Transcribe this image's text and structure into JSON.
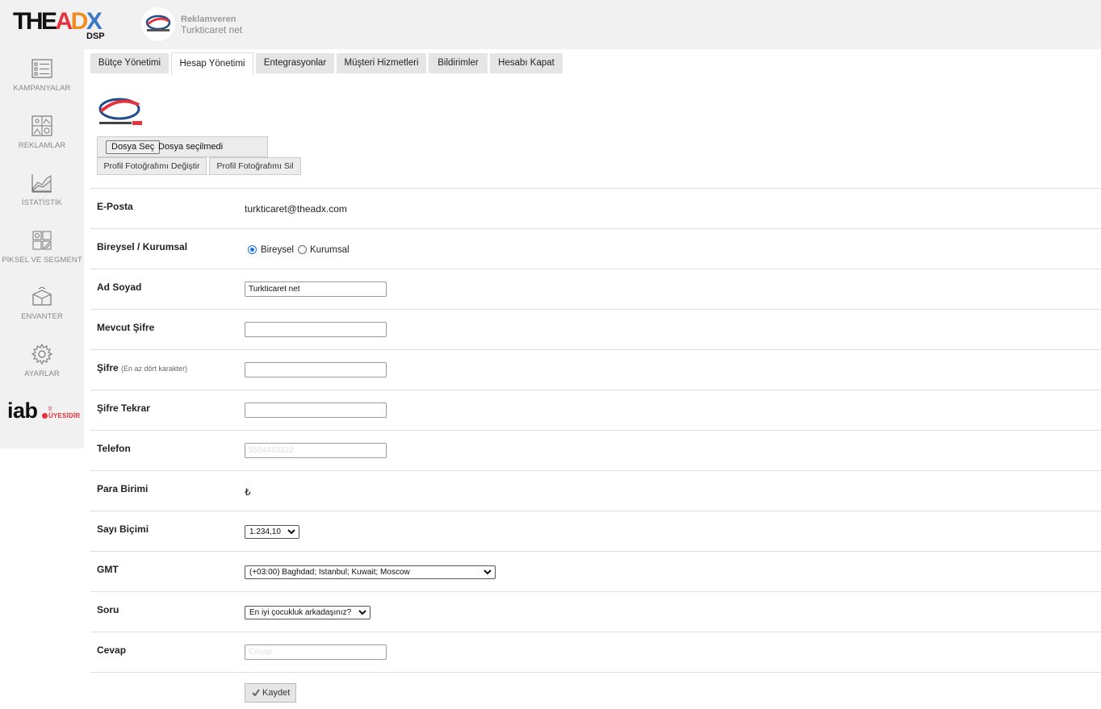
{
  "brand": {
    "logo_text": "THEADX",
    "logo_sub": "DSP"
  },
  "advertiser": {
    "role": "Reklamveren",
    "name": "Turkticaret net"
  },
  "sidebar": {
    "items": [
      {
        "label": "KAMPANYALAR",
        "icon": "campaigns-list-icon"
      },
      {
        "label": "REKLAMLAR",
        "icon": "ads-images-icon"
      },
      {
        "label": "İSTATİSTİK",
        "icon": "statistics-chart-icon"
      },
      {
        "label": "PİKSEL VE SEGMENT",
        "icon": "pixel-segment-icon"
      },
      {
        "label": "ENVANTER",
        "icon": "inventory-box-icon"
      },
      {
        "label": "AYARLAR",
        "icon": "settings-gear-icon"
      }
    ],
    "iab": {
      "main": "iab",
      "sub1": "tr",
      "sub2": "ÜYESİDİR"
    }
  },
  "tabs": [
    {
      "label": "Bütçe Yönetimi",
      "active": false
    },
    {
      "label": "Hesap Yönetimi",
      "active": true
    },
    {
      "label": "Entegrasyonlar",
      "active": false
    },
    {
      "label": "Müşteri Hizmetleri",
      "active": false
    },
    {
      "label": "Bildirimler",
      "active": false
    },
    {
      "label": "Hesabı Kapat",
      "active": false
    }
  ],
  "profile": {
    "file_button": "Dosya Seç",
    "file_status": "Dosya seçilmedi",
    "change_button": "Profil Fotoğrafımı Değiştir",
    "delete_button": "Profil Fotoğrafımı Sil"
  },
  "form": {
    "email": {
      "label": "E-Posta",
      "value": "turkticaret@theadx.com"
    },
    "account_type": {
      "label": "Bireysel / Kurumsal",
      "options": [
        "Bireysel",
        "Kurumsal"
      ],
      "selected": "Bireysel"
    },
    "name": {
      "label": "Ad Soyad",
      "value": "Turkticaret net"
    },
    "current_password": {
      "label": "Mevcut Şifre",
      "value": ""
    },
    "password": {
      "label": "Şifre",
      "hint": "(En az dört karakter)",
      "value": ""
    },
    "password_repeat": {
      "label": "Şifre Tekrar",
      "value": ""
    },
    "phone": {
      "label": "Telefon",
      "value": "",
      "placeholder": "5554443322"
    },
    "currency": {
      "label": "Para Birimi",
      "value": "₺"
    },
    "number_format": {
      "label": "Sayı Biçimi",
      "value": "1.234,10"
    },
    "gmt": {
      "label": "GMT",
      "value": "(+03:00) Baghdad; Istanbul; Kuwait; Moscow"
    },
    "question": {
      "label": "Soru",
      "value": "En iyi çocukluk arkadaşınız?"
    },
    "answer": {
      "label": "Cevap",
      "value": "",
      "placeholder": "Cevap"
    },
    "save_button": "Kaydet"
  },
  "colors": {
    "sidebar_bg": "#f1f1f1",
    "tab_bg": "#e5e5e5",
    "accent_red": "#e6323c",
    "radio_blue": "#1a73e8"
  }
}
